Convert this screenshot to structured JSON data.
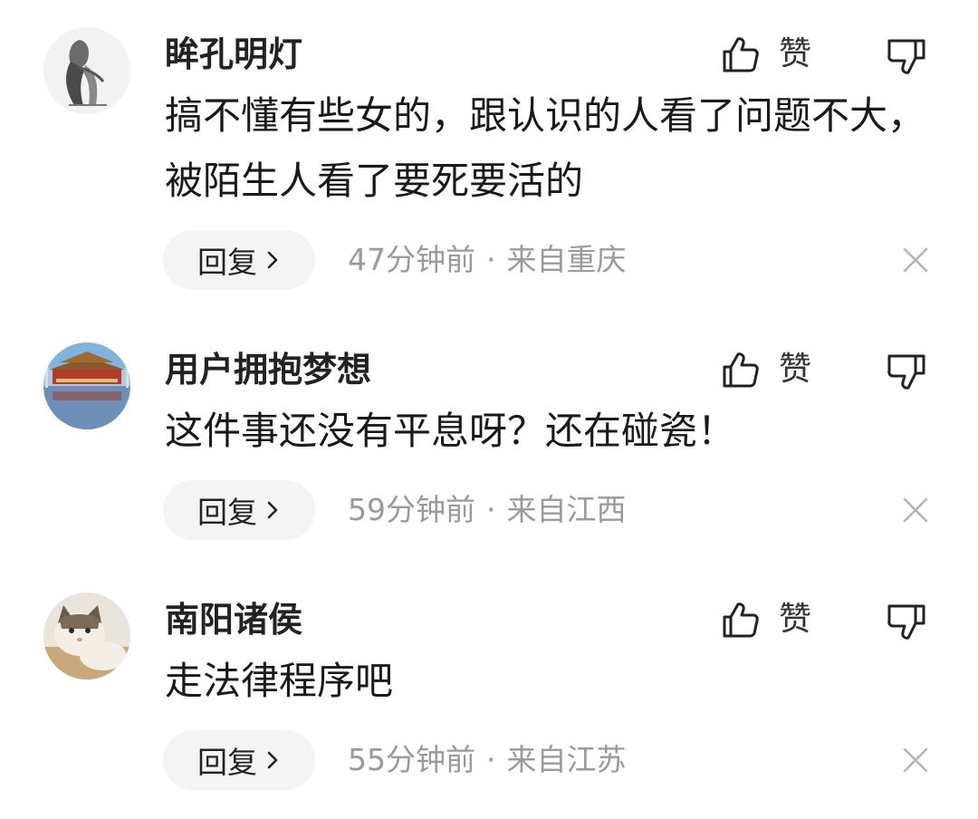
{
  "comments": [
    {
      "username": "眸孔明灯",
      "avatar": "sitting-figure-sketch-avatar",
      "content": "搞不懂有些女的，跟认识的人看了问题不大，被陌生人看了要死要活的",
      "like_label": "赞",
      "reply_label": "回复",
      "time": "47分钟前",
      "separator": "·",
      "location": "来自重庆"
    },
    {
      "username": "用户拥抱梦想",
      "avatar": "tiananmen-photo-avatar",
      "content": "这件事还没有平息呀？还在碰瓷！",
      "like_label": "赞",
      "reply_label": "回复",
      "time": "59分钟前",
      "separator": "·",
      "location": "来自江西"
    },
    {
      "username": "南阳诸侯",
      "avatar": "cat-photo-avatar",
      "content": "走法律程序吧",
      "like_label": "赞",
      "reply_label": "回复",
      "time": "55分钟前",
      "separator": "·",
      "location": "来自江苏"
    }
  ],
  "colors": {
    "text_primary": "#1a1a1a",
    "text_meta": "#9a9a9a",
    "reply_bg": "#f4f4f4",
    "icon": "#333333"
  }
}
